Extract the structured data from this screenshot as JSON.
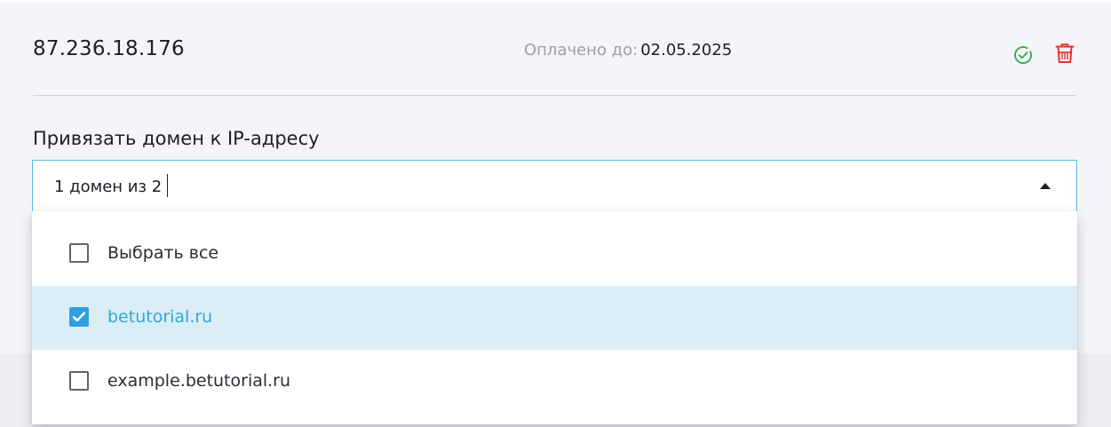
{
  "ip_row": {
    "address": "87.236.18.176",
    "paid_label": "Оплачено до:",
    "paid_date": "02.05.2025",
    "icons": {
      "confirm": "check-circle-icon",
      "delete": "trash-icon"
    },
    "colors": {
      "confirm": "#2fa84f",
      "delete": "#e2312c"
    }
  },
  "bind_domain": {
    "label": "Привязать домен к IP-адресу",
    "select_value": "1 домен из 2",
    "options": [
      {
        "label": "Выбрать все",
        "checked": false
      },
      {
        "label": "betutorial.ru",
        "checked": true
      },
      {
        "label": "example.betutorial.ru",
        "checked": false
      }
    ]
  },
  "colors": {
    "accent": "#2f9ee3",
    "selected_row": "#daedf5",
    "focus_border": "#5bbce0"
  }
}
